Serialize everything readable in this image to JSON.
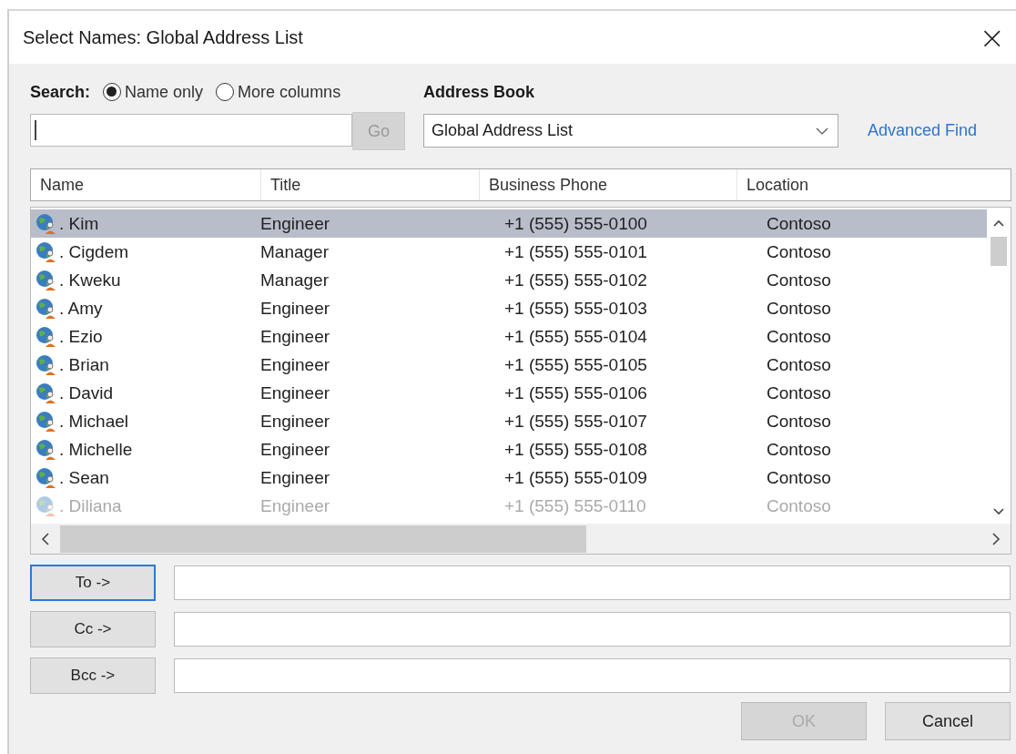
{
  "window": {
    "title": "Select Names: Global Address List",
    "close": "×"
  },
  "search": {
    "label": "Search:",
    "options": [
      {
        "label": "Name only",
        "selected": true
      },
      {
        "label": "More columns",
        "selected": false
      }
    ],
    "go": {
      "label": "Go",
      "disabled": true
    }
  },
  "address_book": {
    "label": "Address Book",
    "value": "Global Address List",
    "advanced": "Advanced Find"
  },
  "table": {
    "columns": [
      "Name",
      "Title",
      "Business Phone",
      "Location"
    ],
    "rows": [
      {
        "name": ". Kim",
        "title": "Engineer",
        "phone": "+1 (555) 555-0100",
        "location": "Contoso",
        "selected": true,
        "faded": false
      },
      {
        "name": ". Cigdem",
        "title": "Manager",
        "phone": "+1 (555) 555-0101",
        "location": "Contoso",
        "selected": false,
        "faded": false
      },
      {
        "name": ". Kweku",
        "title": "Manager",
        "phone": "+1 (555) 555-0102",
        "location": "Contoso",
        "selected": false,
        "faded": false
      },
      {
        "name": ". Amy",
        "title": "Engineer",
        "phone": "+1 (555) 555-0103",
        "location": "Contoso",
        "selected": false,
        "faded": false
      },
      {
        "name": ". Ezio",
        "title": "Engineer",
        "phone": "+1 (555) 555-0104",
        "location": "Contoso",
        "selected": false,
        "faded": false
      },
      {
        "name": ". Brian",
        "title": "Engineer",
        "phone": "+1 (555) 555-0105",
        "location": "Contoso",
        "selected": false,
        "faded": false
      },
      {
        "name": ". David",
        "title": "Engineer",
        "phone": "+1 (555) 555-0106",
        "location": "Contoso",
        "selected": false,
        "faded": false
      },
      {
        "name": ". Michael",
        "title": "Engineer",
        "phone": "+1 (555) 555-0107",
        "location": "Contoso",
        "selected": false,
        "faded": false
      },
      {
        "name": ". Michelle",
        "title": "Engineer",
        "phone": "+1 (555) 555-0108",
        "location": "Contoso",
        "selected": false,
        "faded": false
      },
      {
        "name": ". Sean",
        "title": "Engineer",
        "phone": "+1 (555) 555-0109",
        "location": "Contoso",
        "selected": false,
        "faded": false
      },
      {
        "name": ". Diliana",
        "title": "Engineer",
        "phone": "+1 (555) 555-0110",
        "location": "Contoso",
        "selected": false,
        "faded": true
      }
    ]
  },
  "recipients": [
    {
      "label": "To ->",
      "focused": true
    },
    {
      "label": "Cc ->",
      "focused": false
    },
    {
      "label": "Bcc ->",
      "focused": false
    }
  ],
  "buttons": [
    {
      "label": "OK",
      "disabled": true
    },
    {
      "label": "Cancel",
      "disabled": false
    }
  ]
}
